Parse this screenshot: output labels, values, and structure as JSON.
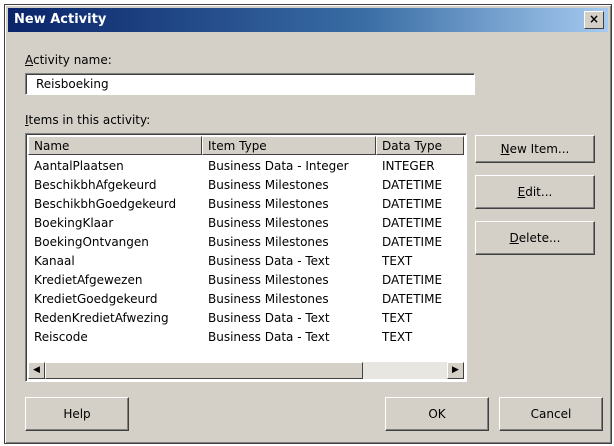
{
  "dialog": {
    "title": "New Activity",
    "close_symbol": "×"
  },
  "activity_name": {
    "label_hotkey": "A",
    "label_rest": "ctivity name:",
    "value": "Reisboeking"
  },
  "items": {
    "label_hotkey": "I",
    "label_rest": "tems in this activity:",
    "columns": [
      "Name",
      "Item Type",
      "Data Type"
    ],
    "rows": [
      [
        "AantalPlaatsen",
        "Business Data - Integer",
        "INTEGER"
      ],
      [
        "BeschikbhAfgekeurd",
        "Business Milestones",
        "DATETIME"
      ],
      [
        "BeschikbhGoedgekeurd",
        "Business Milestones",
        "DATETIME"
      ],
      [
        "BoekingKlaar",
        "Business Milestones",
        "DATETIME"
      ],
      [
        "BoekingOntvangen",
        "Business Milestones",
        "DATETIME"
      ],
      [
        "Kanaal",
        "Business Data - Text",
        "TEXT"
      ],
      [
        "KredietAfgewezen",
        "Business Milestones",
        "DATETIME"
      ],
      [
        "KredietGoedgekeurd",
        "Business Milestones",
        "DATETIME"
      ],
      [
        "RedenKredietAfwezing",
        "Business Data - Text",
        "TEXT"
      ],
      [
        "Reiscode",
        "Business Data - Text",
        "TEXT"
      ]
    ],
    "scroll_left_symbol": "◀",
    "scroll_right_symbol": "▶"
  },
  "buttons": {
    "new_item_hotkey": "N",
    "new_item_rest": "ew Item...",
    "edit_hotkey": "E",
    "edit_rest": "dit...",
    "delete_hotkey": "D",
    "delete_rest": "elete...",
    "help": "Help",
    "ok": "OK",
    "cancel": "Cancel"
  }
}
